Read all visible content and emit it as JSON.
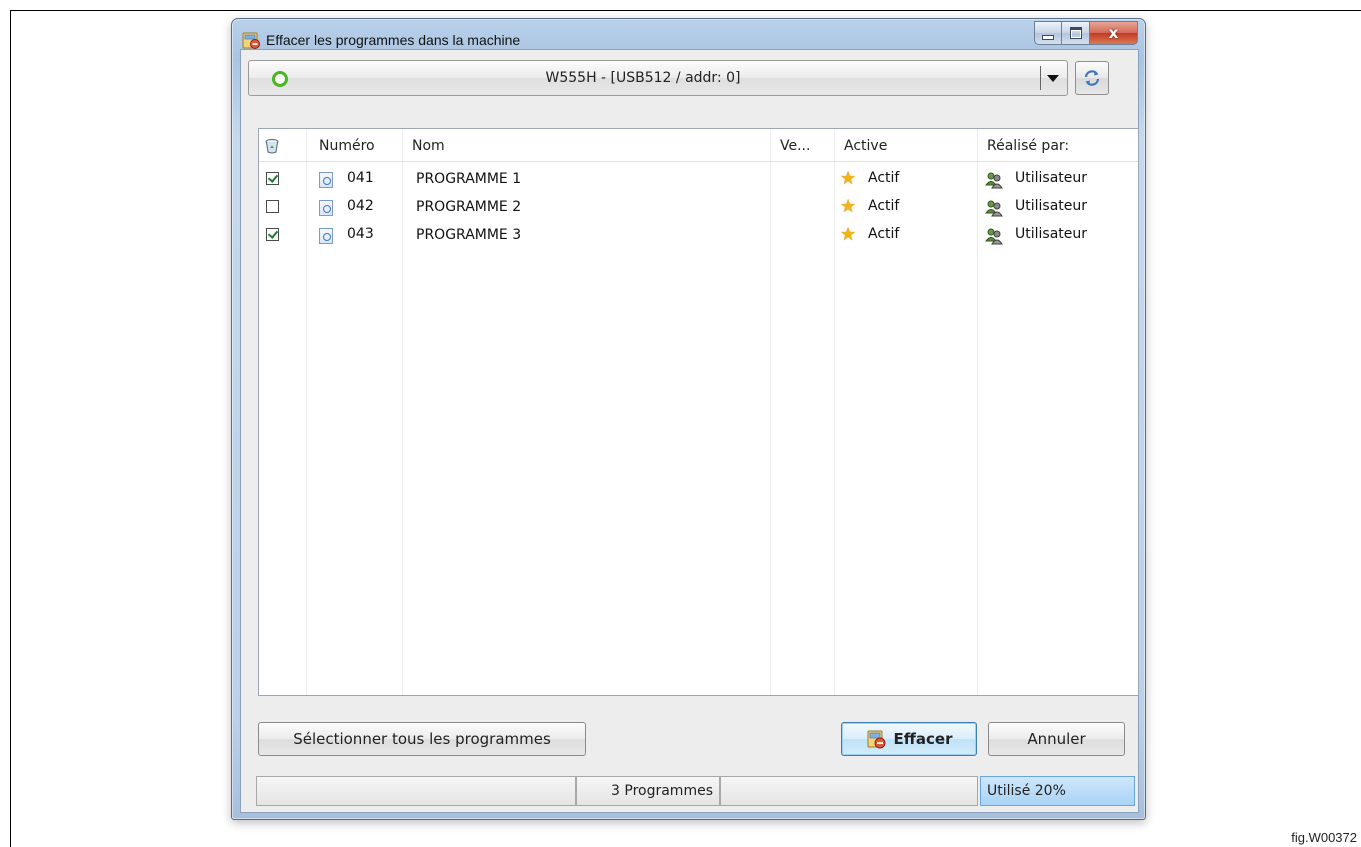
{
  "figure_label": "fig.W00372",
  "window": {
    "title": "Effacer les programmes dans la machine",
    "icon": "erase-programs-icon",
    "close_glyph": "x"
  },
  "machine_selector": {
    "value": "W555H - [USB512 / addr: 0]",
    "status": "connected",
    "status_color": "#49b520"
  },
  "table": {
    "headers": {
      "select": "",
      "number": "Numéro",
      "name": "Nom",
      "version": "Ve...",
      "active": "Active",
      "made_by": "Réalisé par:"
    },
    "rows": [
      {
        "checked": true,
        "number": "041",
        "name": "PROGRAMME 1",
        "version": "",
        "active": "Actif",
        "made_by": "Utilisateur"
      },
      {
        "checked": false,
        "number": "042",
        "name": "PROGRAMME 2",
        "version": "",
        "active": "Actif",
        "made_by": "Utilisateur"
      },
      {
        "checked": true,
        "number": "043",
        "name": "PROGRAMME 3",
        "version": "",
        "active": "Actif",
        "made_by": "Utilisateur"
      }
    ]
  },
  "buttons": {
    "select_all": "Sélectionner tous les programmes",
    "erase": "Effacer",
    "cancel": "Annuler"
  },
  "statusbar": {
    "cell1": "",
    "count": "3 Programmes",
    "cell3": "",
    "usage": "Utilisé 20%"
  }
}
